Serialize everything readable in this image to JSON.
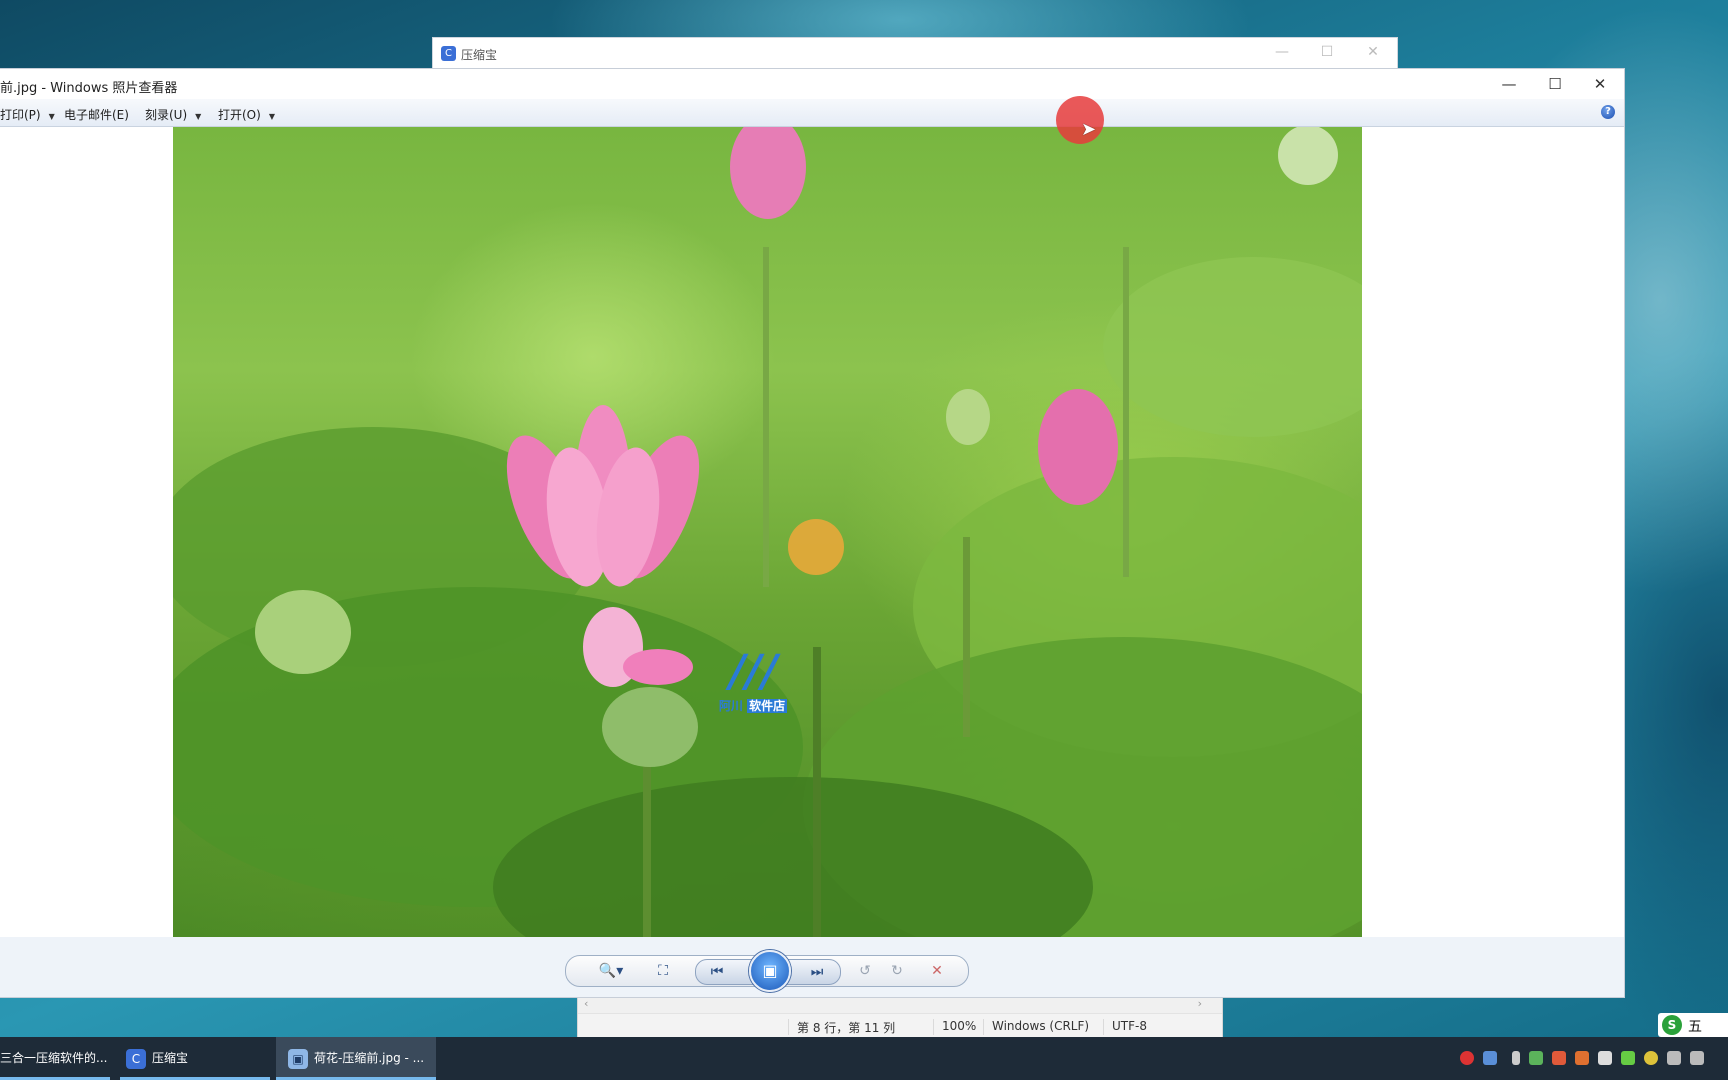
{
  "back_window": {
    "title": "压缩宝",
    "minimize": "—",
    "maximize": "☐",
    "close": "✕"
  },
  "viewer": {
    "title": "前.jpg - Windows 照片查看器",
    "window_controls": {
      "minimize": "—",
      "maximize": "☐",
      "close": "✕"
    },
    "menu": [
      {
        "label": "打印(P)"
      },
      {
        "label": "电子邮件(E)"
      },
      {
        "label": "刻录(U)"
      },
      {
        "label": "打开(O)"
      }
    ],
    "help": "?",
    "watermark": {
      "logo": "///",
      "text_left": "阿川",
      "text_right": "软件店"
    },
    "controls": {
      "zoom": "🔍▾",
      "fit": "⛶",
      "prev": "⏮",
      "slideshow": "▣",
      "next": "⏭",
      "rotate_left": "↺",
      "rotate_right": "↻",
      "delete": "✕"
    }
  },
  "notepad_status": {
    "position": "第 8 行，第 11 列",
    "zoom": "100%",
    "line_ending": "Windows (CRLF)",
    "encoding": "UTF-8"
  },
  "taskbar": {
    "items": [
      {
        "label": "三合一压缩软件的..."
      },
      {
        "label": "压缩宝"
      },
      {
        "label": "荷花-压缩前.jpg - ..."
      }
    ]
  },
  "ime": {
    "logo": "S",
    "mode": "五"
  }
}
